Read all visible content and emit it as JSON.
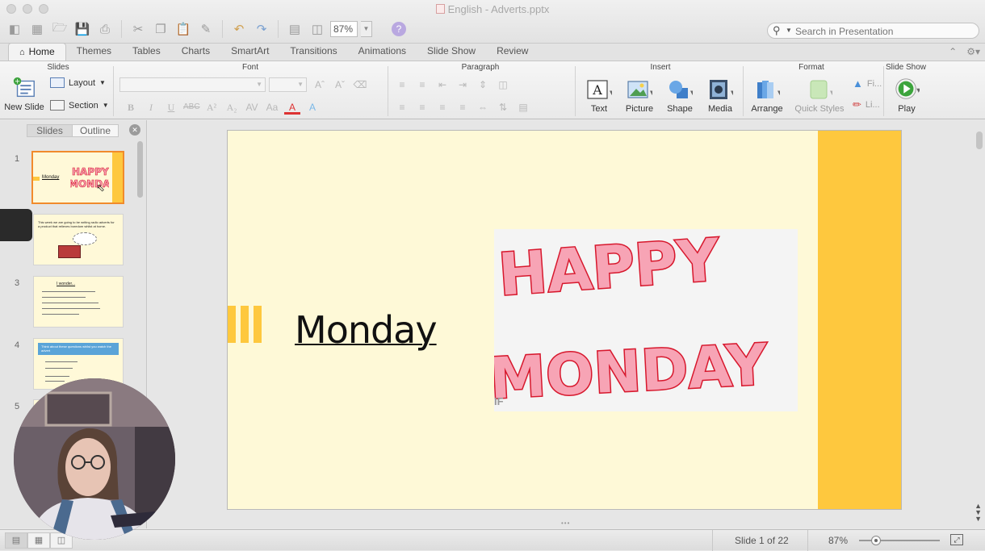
{
  "window": {
    "title": "English - Adverts.pptx"
  },
  "toolbar": {
    "zoom_value": "87%"
  },
  "search": {
    "placeholder": "Search in Presentation"
  },
  "tabs": [
    "Home",
    "Themes",
    "Tables",
    "Charts",
    "SmartArt",
    "Transitions",
    "Animations",
    "Slide Show",
    "Review"
  ],
  "ribbon": {
    "groups": {
      "slides": "Slides",
      "font": "Font",
      "paragraph": "Paragraph",
      "insert": "Insert",
      "format": "Format",
      "slideshow": "Slide Show"
    },
    "new_slide": "New Slide",
    "layout": "Layout",
    "section": "Section",
    "text": "Text",
    "picture": "Picture",
    "shape": "Shape",
    "media": "Media",
    "arrange": "Arrange",
    "quick_styles": "Quick Styles",
    "fill": "Fi...",
    "line": "Li...",
    "play": "Play"
  },
  "panel": {
    "tab_slides": "Slides",
    "tab_outline": "Outline"
  },
  "thumbnails": [
    {
      "num": "1",
      "title": "Monday"
    },
    {
      "num": "",
      "text": "This week we are going to be writing radio adverts for a product that relieves boredom whilst at home."
    },
    {
      "num": "3",
      "title": "I wonder..."
    },
    {
      "num": "4",
      "title": "Think about these questions whilst you watch the advert"
    },
    {
      "num": "5"
    }
  ],
  "slide": {
    "title": "Monday",
    "picture_line1": "HAPPY",
    "picture_line2": "MONDAY",
    "picture_caption": "IF"
  },
  "status": {
    "slide_counter": "Slide 1 of 22",
    "zoom": "87%"
  },
  "colors": {
    "slide_bg": "#fef9d7",
    "accent_yellow": "#fec83e",
    "happy_fill": "#f7a4b5",
    "happy_stroke": "#d7172c",
    "selection": "#f18b2c"
  }
}
